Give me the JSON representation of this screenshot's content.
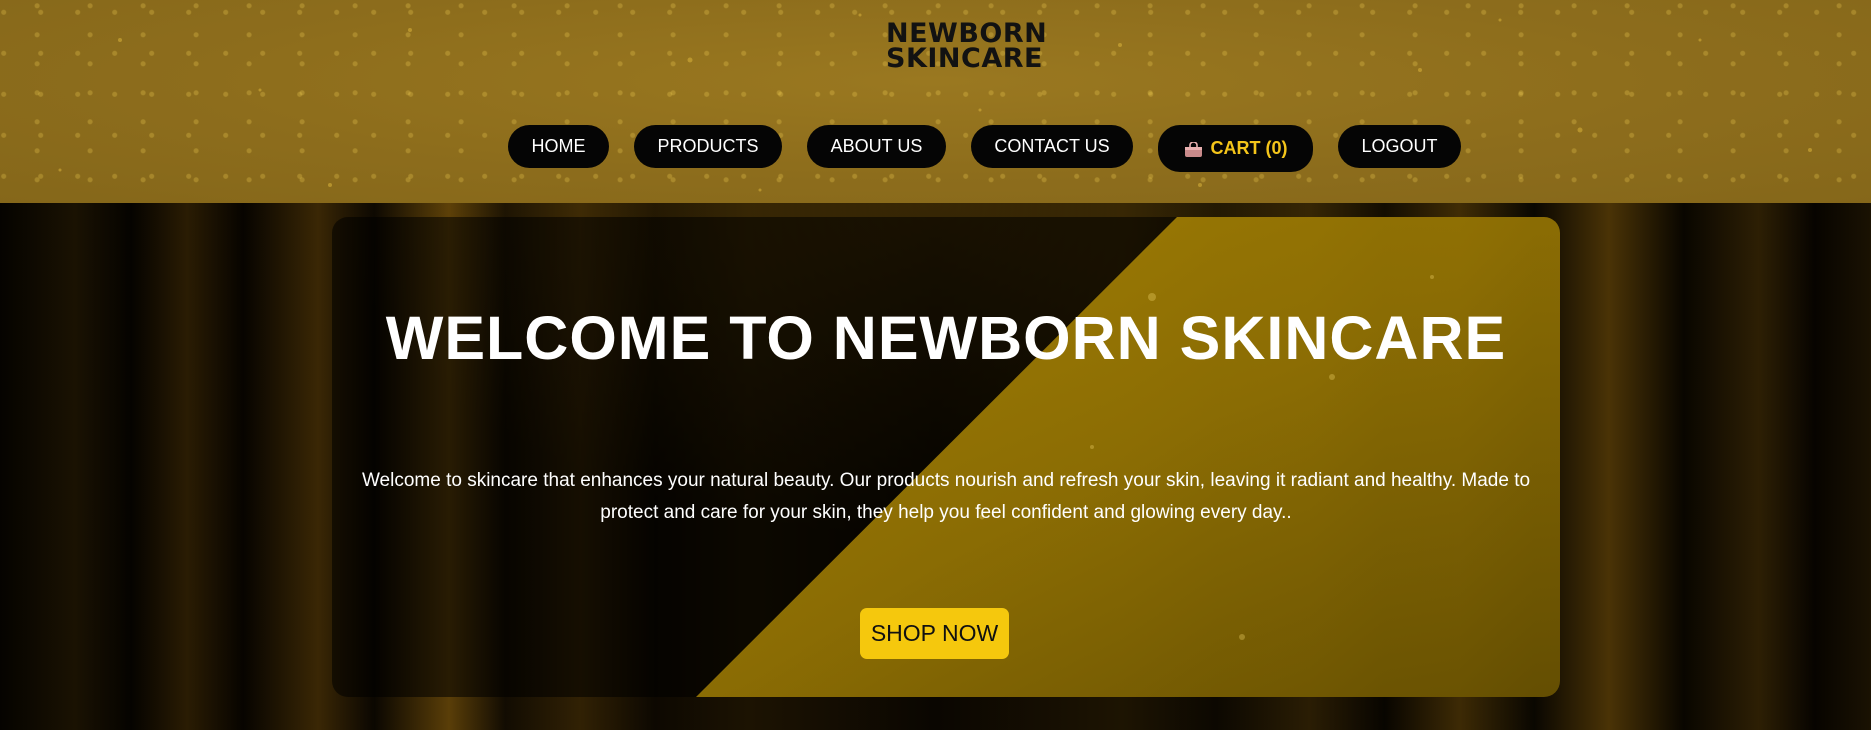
{
  "brand": {
    "logo_line1": "NEWBORN",
    "logo_line2": "SKINCARE"
  },
  "nav": {
    "items": [
      {
        "label": "HOME"
      },
      {
        "label": "PRODUCTS"
      },
      {
        "label": "ABOUT US"
      },
      {
        "label": "CONTACT US"
      },
      {
        "label": "CART (0)",
        "icon": "shopping-bag-icon"
      },
      {
        "label": "LOGOUT"
      }
    ]
  },
  "hero": {
    "title": "WELCOME TO NEWBORN SKINCARE",
    "text": "Welcome to skincare that enhances your natural beauty. Our products nourish and refresh your skin, leaving it radiant and healthy. Made to protect and care for your skin, they help you feel confident and glowing every day..",
    "cta_label": "SHOP NOW"
  },
  "colors": {
    "header_bg": "#8d6d1c",
    "nav_button_bg": "#050505",
    "cart_text": "#f4c51a",
    "cta_bg": "#f5c80d",
    "panel_gold": "#9c7a04"
  }
}
